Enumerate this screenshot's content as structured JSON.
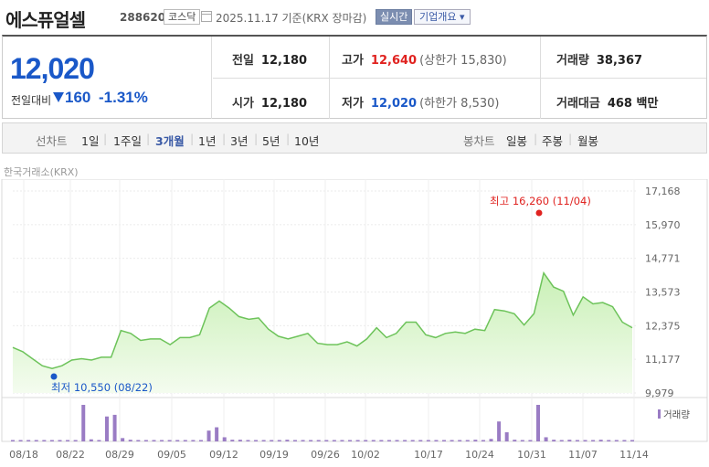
{
  "header": {
    "stock_name": "에스퓨얼셀",
    "stock_code": "288620",
    "market": "코스닥",
    "date_note": "2025.11.17 기준(KRX 장마감)",
    "realtime_label": "실시간",
    "company_info_label": "기업개요 ▾"
  },
  "quote": {
    "price": "12,020",
    "change_label": "전일대비",
    "change_value": "160",
    "change_pct": "-1.31%",
    "prev_close_label": "전일",
    "prev_close": "12,180",
    "open_label": "시가",
    "open": "12,180",
    "high_label": "고가",
    "high": "12,640",
    "upper_limit_label": "(상한가 15,830)",
    "low_label": "저가",
    "low": "12,020",
    "lower_limit_label": "(하한가 8,530)",
    "volume_label": "거래량",
    "volume": "38,367",
    "amount_label": "거래대금",
    "amount": "468 백만"
  },
  "period_bar": {
    "line_label": "선차트",
    "line_periods": [
      "1일",
      "1주일",
      "3개월",
      "1년",
      "3년",
      "5년",
      "10년"
    ],
    "selected": "3개월",
    "candle_label": "봉차트",
    "candle_periods": [
      "일봉",
      "주봉",
      "월봉"
    ]
  },
  "source_label": "한국거래소(KRX)",
  "colors": {
    "down": "#1a58c8",
    "up": "#e0221f",
    "line": "#6dc35a",
    "area": "#c9f0b6",
    "volume": "#9a7cc4"
  },
  "chart_data": {
    "type": "area",
    "y_ticks": [
      17168,
      15970,
      14771,
      13573,
      12375,
      11177,
      9979
    ],
    "ylim": [
      9979,
      17168
    ],
    "x_tick_labels": [
      "08/18",
      "08/22",
      "08/29",
      "09/05",
      "09/12",
      "09/19",
      "09/26",
      "10/02",
      "10/17",
      "10/24",
      "10/31",
      "11/07",
      "11/14"
    ],
    "max_annotation": "최고 16,260 (11/04)",
    "min_annotation": "최저 10,550 (08/22)",
    "volume_legend": "거래량",
    "prices": [
      11600,
      11450,
      11200,
      10950,
      10850,
      10950,
      11150,
      11200,
      11150,
      11250,
      11250,
      12200,
      12100,
      11850,
      11900,
      11900,
      11700,
      11950,
      11950,
      12050,
      13000,
      13250,
      13000,
      12700,
      12600,
      12650,
      12250,
      12000,
      11900,
      12000,
      12100,
      11750,
      11700,
      11700,
      11800,
      11650,
      11900,
      12300,
      11950,
      12100,
      12500,
      12500,
      12050,
      11950,
      12100,
      12150,
      12100,
      12250,
      12200,
      12950,
      12900,
      12800,
      12400,
      12800,
      14250,
      13750,
      13600,
      12750,
      13400,
      13150,
      13200,
      13050,
      12500,
      12300
    ],
    "volumes": [
      2,
      2,
      2,
      2,
      2,
      2,
      3,
      3,
      2,
      88,
      5,
      2,
      60,
      64,
      8,
      4,
      2,
      2,
      2,
      2,
      3,
      2,
      2,
      2,
      2,
      26,
      34,
      10,
      4,
      4,
      2,
      3,
      2,
      2,
      2,
      4,
      2,
      3,
      3,
      3,
      2,
      2,
      2,
      2,
      2,
      2,
      2,
      2,
      2,
      3,
      2,
      2,
      2,
      3,
      2,
      2,
      3,
      3,
      3,
      4,
      2,
      6,
      48,
      22,
      4,
      2,
      3,
      88,
      10,
      4,
      3,
      4,
      3,
      2,
      2,
      4,
      3,
      3,
      2,
      2
    ]
  }
}
